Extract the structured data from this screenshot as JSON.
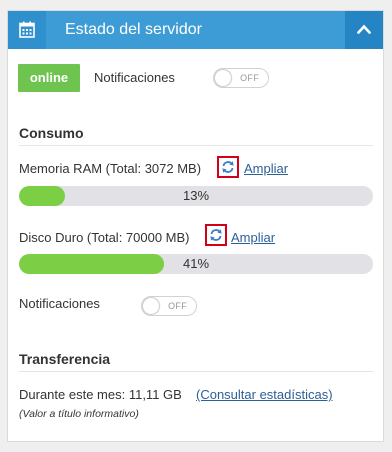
{
  "header": {
    "title": "Estado del servidor",
    "calendar_icon": "calendar-icon",
    "collapse_icon": "chevron-up-icon"
  },
  "status": {
    "badge": "online",
    "notifications_label": "Notificaciones",
    "toggle_label": "OFF"
  },
  "consumo": {
    "title": "Consumo",
    "ram": {
      "label": "Memoria RAM (Total: 3072 MB)",
      "link": "Ampliar",
      "percent": 13,
      "percent_text": "13%"
    },
    "disk": {
      "label": "Disco Duro (Total: 70000 MB)",
      "link": "Ampliar",
      "percent": 41,
      "percent_text": "41%"
    },
    "notifications_label": "Notificaciones",
    "toggle_label": "OFF"
  },
  "transferencia": {
    "title": "Transferencia",
    "month_label": "Durante este mes: 11,11 GB",
    "stats_link": "(Consultar estadísticas)",
    "note": "(Valor a título informativo)"
  },
  "colors": {
    "header": "#3d9cd6",
    "online": "#6fc34f",
    "progress": "#7cce45",
    "highlight": "#d0021b",
    "link": "#2b5f97"
  }
}
